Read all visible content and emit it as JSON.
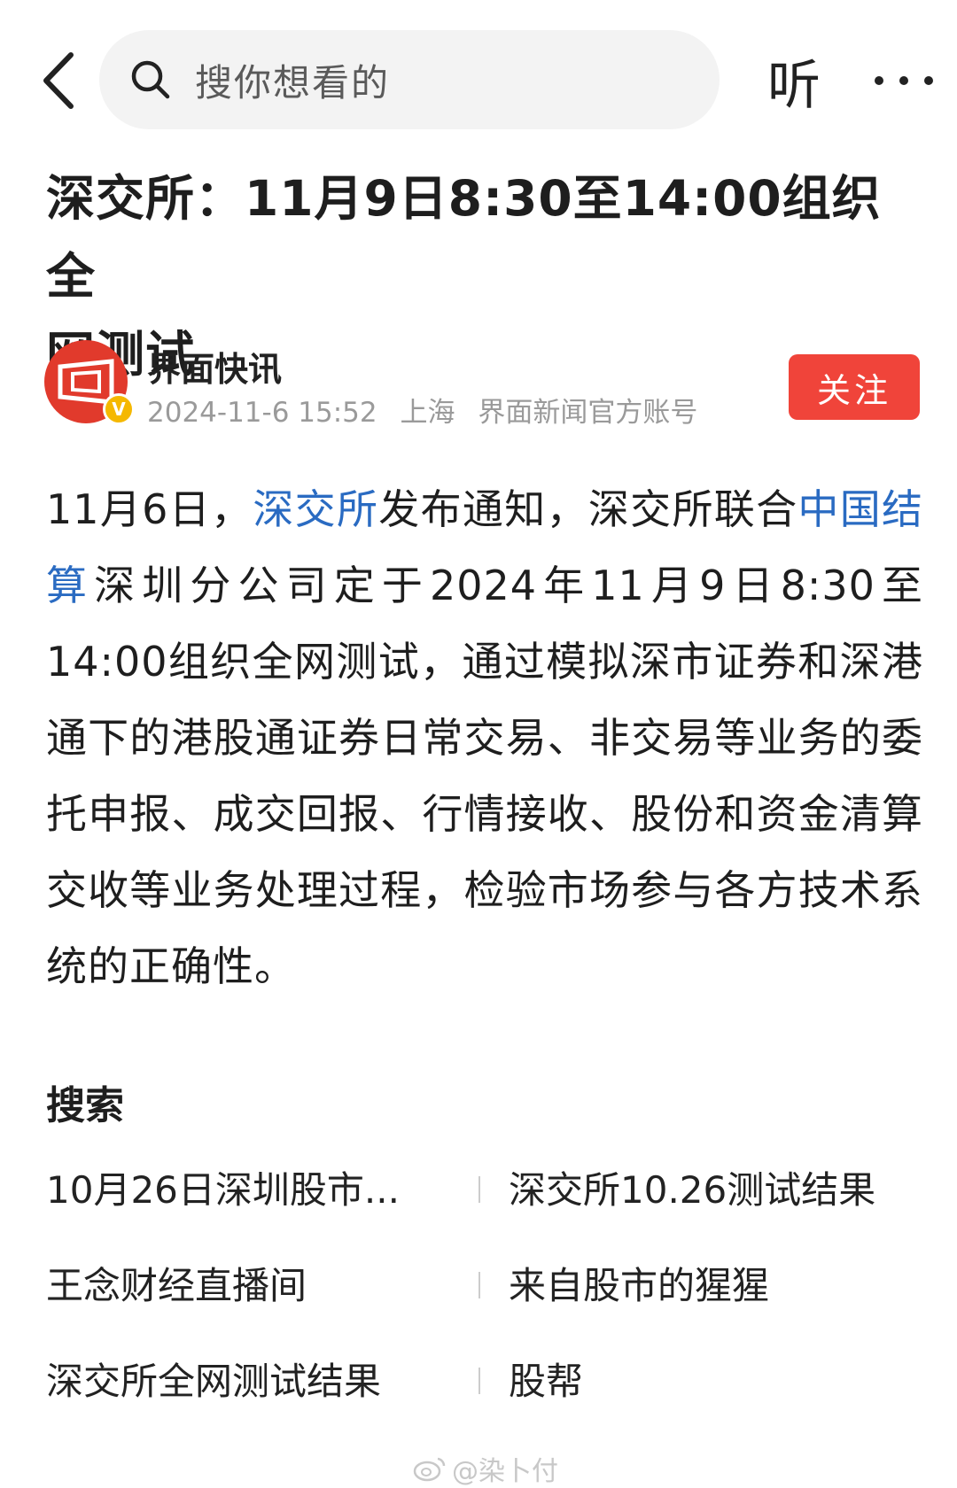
{
  "header": {
    "search_placeholder": "搜你想看的",
    "listen_label": "听"
  },
  "article": {
    "title_line1": "深交所：11月9日8:30至14:00组织全",
    "title_line2": "网测试",
    "author": {
      "name": "界面快讯",
      "verified_badge": "V",
      "datetime": "2024-11-6 15:52",
      "location": "上海",
      "account_type": "界面新闻官方账号",
      "follow_label": "关注"
    },
    "body": {
      "part1": "11月6日，",
      "link1": "深交所",
      "part2": "发布通知，深交所联合",
      "link2": "中国结算",
      "part3": "深圳分公司定于2024年11月9日8:30至14:00组织全网测试，通过模拟深市证券和深港通下的港股通证券日常交易、非交易等业务的委托申报、成交回报、行情接收、股份和资金清算交收等业务处理过程，检验市场参与各方技术系统的正确性。"
    }
  },
  "search_section": {
    "title": "搜索",
    "items": [
      {
        "left": "10月26日深圳股市...",
        "right": "深交所10.26测试结果"
      },
      {
        "left": "王念财经直播间",
        "right": "来自股市的猩猩"
      },
      {
        "left": "深交所全网测试结果",
        "right": "股帮"
      }
    ]
  },
  "watermark": "@染卜付",
  "colors": {
    "link": "#2a6bc2",
    "follow_button": "#f0443a",
    "avatar": "#e13a2c",
    "badge": "#f5b800"
  }
}
